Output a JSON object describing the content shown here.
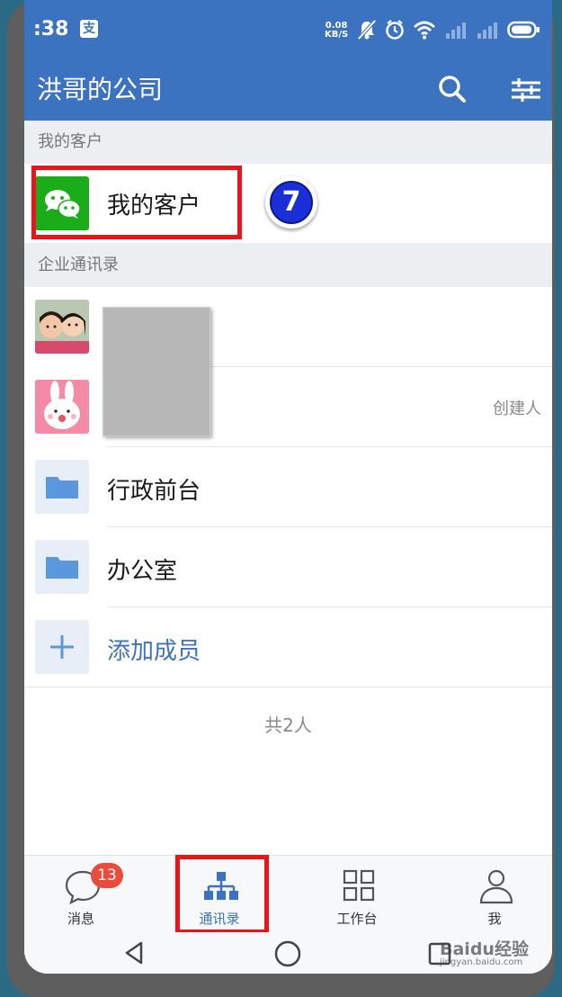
{
  "status_bar": {
    "time": ":38",
    "net_speed_value": "0.08",
    "net_speed_unit": "KB/S",
    "app_icon_glyph": "支"
  },
  "header": {
    "title": "洪哥的公司",
    "icons": [
      "search-icon",
      "filter-sliders-icon"
    ]
  },
  "sections": {
    "customers_header": "我的客户",
    "customers_item_label": "我的客户",
    "directory_header": "企业通讯录"
  },
  "annotation": {
    "step_number": "7"
  },
  "contacts": [
    {
      "role_tag": ""
    },
    {
      "role_tag": "创建人"
    }
  ],
  "departments": [
    {
      "label": "行政前台",
      "icon": "folder-icon"
    },
    {
      "label": "办公室",
      "icon": "folder-icon"
    }
  ],
  "add_member": {
    "label": "添加成员",
    "icon": "plus-icon"
  },
  "total_count": "共2人",
  "tabs": [
    {
      "label": "消息",
      "icon": "chat-bubble-icon",
      "badge": "13"
    },
    {
      "label": "通讯录",
      "icon": "org-chart-icon",
      "active": true
    },
    {
      "label": "工作台",
      "icon": "grid-icon"
    },
    {
      "label": "我",
      "icon": "person-icon"
    }
  ],
  "watermark": {
    "text": "Baidu经验",
    "subtext": "jingyan.baidu.com"
  },
  "colors": {
    "brand_blue": "#3c73c0",
    "annotation_red": "#e8151a",
    "badge_red": "#e94b3c",
    "wechat_green": "#1aad19"
  }
}
